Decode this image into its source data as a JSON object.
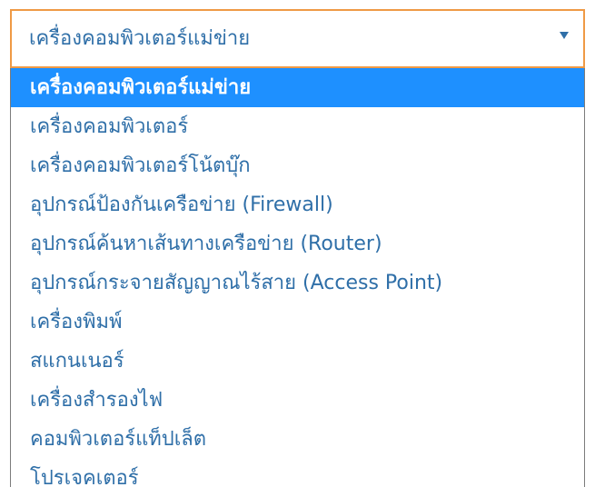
{
  "select": {
    "value": "เครื่องคอมพิวเตอร์แม่ข่าย",
    "arrow_icon": "triangle-down-icon"
  },
  "dropdown": {
    "selected_index": 0,
    "options": [
      "เครื่องคอมพิวเตอร์แม่ข่าย",
      "เครื่องคอมพิวเตอร์",
      "เครื่องคอมพิวเตอร์โน้ตบุ๊ก",
      "อุปกรณ์ป้องกันเครือข่าย (Firewall)",
      "อุปกรณ์ค้นหาเส้นทางเครือข่าย (Router)",
      "อุปกรณ์กระจายสัญญาณไร้สาย (Access Point)",
      "เครื่องพิมพ์",
      "สแกนเนอร์",
      "เครื่องสำรองไฟ",
      "คอมพิวเตอร์แท็ปเล็ต",
      "โปรเจคเตอร์"
    ]
  },
  "colors": {
    "text": "#2f6fa8",
    "highlight": "#1e90ff",
    "focus_border": "#ef9a45"
  }
}
